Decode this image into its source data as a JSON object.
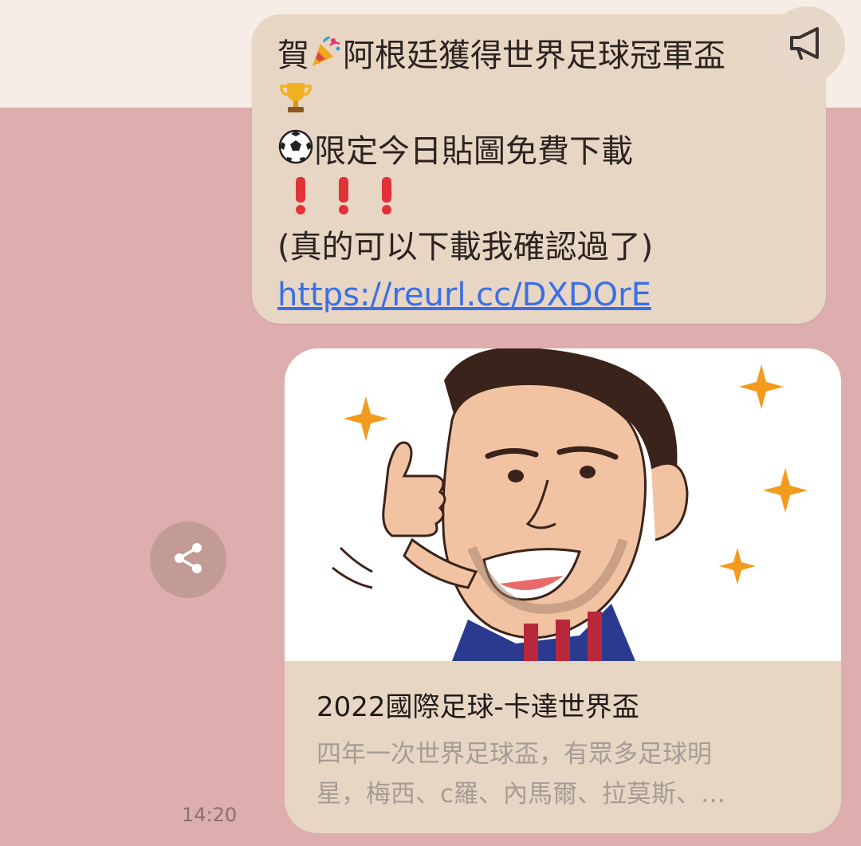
{
  "message": {
    "line1_text": "賀",
    "line1_rest": "阿根廷獲得世界足球冠軍盃",
    "line3_text": "限定今日貼圖免費下載",
    "line5_text": "(真的可以下載我確認過了)",
    "link": "https://reurl.cc/DXDOrE"
  },
  "card": {
    "title": "2022國際足球-卡達世界盃",
    "description_line1": "四年一次世界足球盃，有眾多足球明",
    "description_line2": "星，梅西、c羅、內馬爾、拉莫斯、…"
  },
  "timestamp": "14:20",
  "icons": {
    "announce": "megaphone-icon",
    "share": "share-icon",
    "party": "party-popper-icon",
    "trophy": "trophy-icon",
    "ball": "soccer-ball-icon",
    "exclaim": "red-exclamation-icon"
  },
  "colors": {
    "chat_bg": "#deaeae",
    "bubble_bg": "#e8d6c4",
    "link": "#3b6fe6",
    "share_btn": "#c29c94"
  }
}
